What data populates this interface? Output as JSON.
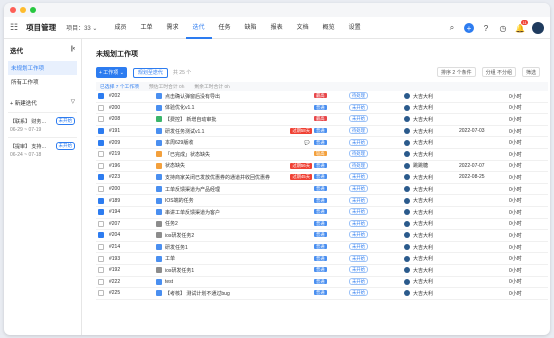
{
  "nav": {
    "project": "项目管理",
    "iteration": "项目：33",
    "tabs": [
      "成员",
      "工单",
      "需求",
      "迭代",
      "任务",
      "缺陷",
      "报表",
      "文档",
      "概览",
      "设置"
    ],
    "active_tab": "迭代",
    "notif_count": "11"
  },
  "sidebar": {
    "title": "迭代",
    "items": [
      "未规划工作项",
      "所有工作项"
    ],
    "add_label": "+ 新建迭代",
    "cards": [
      {
        "name": "【联系】 财务…",
        "badge": "未开始",
        "dates": "06-29 ~ 07-19"
      },
      {
        "name": "【提审】 支持…",
        "badge": "未开始",
        "dates": "06-24 ~ 07-18"
      }
    ]
  },
  "main": {
    "title": "未规划工作项",
    "new_btn": "+ 工作项",
    "plan_btn": "规划至迭代",
    "total": "共 25 个",
    "sort": "排序  2 个条件",
    "group": "分组  不分组",
    "filter": "筛选",
    "summary": [
      "已选择 7 个工作项",
      "预估工时合计 0h",
      "剩余工时合计 0h"
    ]
  },
  "colors": {
    "accent": "#2d7cf0",
    "urgent": "#e8474a",
    "normal": "#4a8ff0",
    "overdue": "#f04134"
  },
  "rows": [
    {
      "checked": true,
      "id": "#202",
      "icon": "blue",
      "title": "点击确认弹窗后没有导出",
      "pri": "最高",
      "pricolor": "#e8474a",
      "status": "待处理",
      "owner": "大吉大利",
      "date": "",
      "est": "0小时"
    },
    {
      "checked": false,
      "id": "#200",
      "icon": "blue",
      "title": "体验优化v1.1",
      "pri": "普通",
      "pricolor": "#4a8ff0",
      "status": "未开始",
      "owner": "大吉大利",
      "date": "",
      "est": "0小时"
    },
    {
      "checked": false,
      "id": "#208",
      "icon": "green",
      "title": "【费控】 新增自动审批",
      "pri": "最高",
      "pricolor": "#e8474a",
      "status": "未开始",
      "owner": "大吉大利",
      "date": "",
      "est": "0小时"
    },
    {
      "checked": true,
      "id": "#191",
      "icon": "blue",
      "title": "研发任务测试v1.1",
      "over": "过期58天",
      "pri": "普通",
      "pricolor": "#4a8ff0",
      "status": "待处理",
      "owner": "大吉大利",
      "date": "2022-07-03",
      "est": "0小时"
    },
    {
      "checked": true,
      "id": "#209",
      "icon": "blue",
      "title": "  本周629版收",
      "cmt": "💬",
      "pri": "普通",
      "pricolor": "#4a8ff0",
      "status": "未开始",
      "owner": "大吉大利",
      "date": "",
      "est": "0小时"
    },
    {
      "checked": false,
      "id": "#219",
      "icon": "orange",
      "title": "「已完成」状态缺失",
      "pri": "较高",
      "pricolor": "#f3a03c",
      "status": "待处理",
      "owner": "大吉大利",
      "date": "",
      "est": "0小时"
    },
    {
      "checked": false,
      "id": "#196",
      "icon": "orange",
      "title": "状态缺失",
      "over": "过期56天",
      "pri": "普通",
      "pricolor": "#4a8ff0",
      "status": "待处理",
      "owner": "跳跳糖",
      "date": "2022-07-07",
      "est": "0小时"
    },
    {
      "checked": true,
      "id": "#223",
      "icon": "blue",
      "title": "支持商家关闭已发放优惠券的通道并收回优惠券",
      "over": "过期45天",
      "pri": "普通",
      "pricolor": "#4a8ff0",
      "status": "未开始",
      "owner": "大吉大利",
      "date": "2022-08-25",
      "est": "0小时"
    },
    {
      "checked": false,
      "id": "#200",
      "icon": "blue",
      "title": "工单反馈渠道为产品经理",
      "pri": "普通",
      "pricolor": "#4a8ff0",
      "status": "未开始",
      "owner": "大吉大利",
      "date": "",
      "est": "0小时"
    },
    {
      "checked": true,
      "id": "#189",
      "icon": "blue",
      "title": "IOS端的任务",
      "pri": "普通",
      "pricolor": "#4a8ff0",
      "status": "未开始",
      "owner": "大吉大利",
      "date": "",
      "est": "0小时"
    },
    {
      "checked": true,
      "id": "#194",
      "icon": "blue",
      "title": "串讲工单反馈渠道为客户",
      "pri": "普通",
      "pricolor": "#4a8ff0",
      "status": "未开始",
      "owner": "大吉大利",
      "date": "",
      "est": "0小时"
    },
    {
      "checked": false,
      "id": "#207",
      "icon": "gray",
      "title": "任务2",
      "pri": "普通",
      "pricolor": "#4a8ff0",
      "status": "未开始",
      "owner": "大吉大利",
      "date": "",
      "est": "0小时"
    },
    {
      "checked": true,
      "id": "#204",
      "icon": "gray",
      "title": "ios研发任务2",
      "pri": "普通",
      "pricolor": "#4a8ff0",
      "status": "未开始",
      "owner": "大吉大利",
      "date": "",
      "est": "0小时"
    },
    {
      "checked": false,
      "id": "#214",
      "icon": "blue",
      "title": "研发任务1",
      "pri": "普通",
      "pricolor": "#4a8ff0",
      "status": "未开始",
      "owner": "大吉大利",
      "date": "",
      "est": "0小时"
    },
    {
      "checked": false,
      "id": "#193",
      "icon": "blue",
      "title": "工单",
      "pri": "普通",
      "pricolor": "#4a8ff0",
      "status": "未开始",
      "owner": "大吉大利",
      "date": "",
      "est": "0小时"
    },
    {
      "checked": false,
      "id": "#192",
      "icon": "gray",
      "title": "ios研发任务1",
      "pri": "普通",
      "pricolor": "#4a8ff0",
      "status": "未开始",
      "owner": "大吉大利",
      "date": "",
      "est": "0小时"
    },
    {
      "checked": false,
      "id": "#222",
      "icon": "blue",
      "title": "test",
      "pri": "普通",
      "pricolor": "#4a8ff0",
      "status": "未开始",
      "owner": "大吉大利",
      "date": "",
      "est": "0小时"
    },
    {
      "checked": false,
      "id": "#225",
      "icon": "blue",
      "title": "【考核】 测试计划不通过bug",
      "pri": "普通",
      "pricolor": "#4a8ff0",
      "status": "未开始",
      "owner": "大吉大利",
      "date": "",
      "est": "0小时"
    }
  ]
}
